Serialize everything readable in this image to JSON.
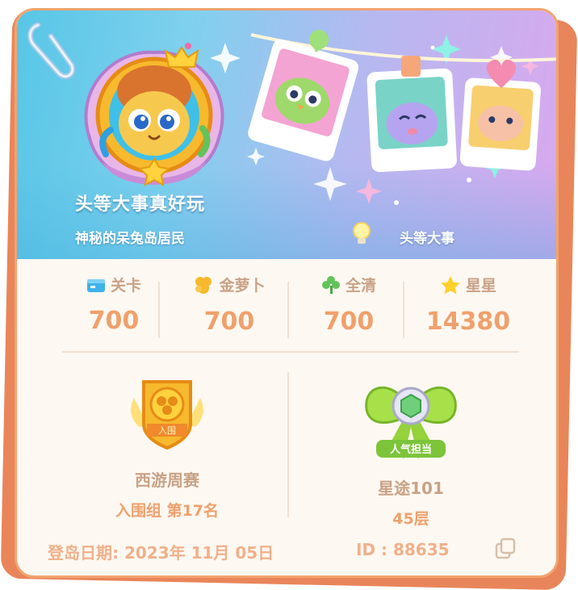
{
  "profile": {
    "name": "头等大事真好玩",
    "title": "神秘的呆兔岛居民",
    "tag": "头等大事"
  },
  "stats": [
    {
      "label": "关卡",
      "value": "700",
      "icon": "level-flag-icon"
    },
    {
      "label": "金萝卜",
      "value": "700",
      "icon": "gold-carrot-icon"
    },
    {
      "label": "全清",
      "value": "700",
      "icon": "clover-icon"
    },
    {
      "label": "星星",
      "value": "14380",
      "icon": "star-icon"
    }
  ],
  "badges": [
    {
      "title": "西游周赛",
      "subtitle": "入围组 第17名",
      "emblem_text": "入围"
    },
    {
      "title": "星途101",
      "subtitle": "45层",
      "emblem_text": "人气担当"
    }
  ],
  "footer": {
    "join_date": "登岛日期: 2023年 11月 05日",
    "id": "ID : 88635"
  },
  "colors": {
    "label": "#c9a287",
    "value": "#f0a06c",
    "card_border": "#f2a36f",
    "card_bg": "#fdf8f1"
  }
}
